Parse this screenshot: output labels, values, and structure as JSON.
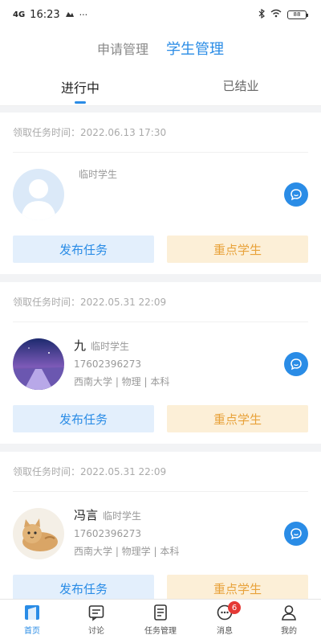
{
  "status_bar": {
    "signal": "4G",
    "time": "16:23",
    "more": "···",
    "battery": "88"
  },
  "top_tabs": [
    {
      "label": "申请管理",
      "active": false
    },
    {
      "label": "学生管理",
      "active": true
    }
  ],
  "sub_tabs": [
    {
      "label": "进行中",
      "active": true
    },
    {
      "label": "已结业",
      "active": false
    }
  ],
  "cards": [
    {
      "time": "领取任务时间：2022.06.13 17:30",
      "name": "",
      "tag": "临时学生",
      "phone": "",
      "school": "",
      "avatar": "default-avatar",
      "publish_label": "发布任务",
      "key_label": "重点学生"
    },
    {
      "time": "领取任务时间：2022.05.31 22:09",
      "name": "九",
      "tag": "临时学生",
      "phone": "17602396273",
      "school": "西南大学 | 物理 | 本科",
      "avatar": "landscape-avatar",
      "publish_label": "发布任务",
      "key_label": "重点学生"
    },
    {
      "time": "领取任务时间：2022.05.31 22:09",
      "name": "冯言",
      "tag": "临时学生",
      "phone": "17602396273",
      "school": "西南大学 | 物理学 | 本科",
      "avatar": "cat-avatar",
      "publish_label": "发布任务",
      "key_label": "重点学生"
    }
  ],
  "bottom_nav": [
    {
      "label": "首页",
      "icon": "home-icon",
      "active": true
    },
    {
      "label": "讨论",
      "icon": "discussion-icon",
      "active": false
    },
    {
      "label": "任务管理",
      "icon": "task-icon",
      "active": false
    },
    {
      "label": "消息",
      "icon": "message-icon",
      "active": false,
      "badge": "6"
    },
    {
      "label": "我的",
      "icon": "profile-icon",
      "active": false
    }
  ],
  "colors": {
    "accent": "#2a8ce6",
    "warm": "#e8a23a",
    "badge": "#e53935"
  }
}
